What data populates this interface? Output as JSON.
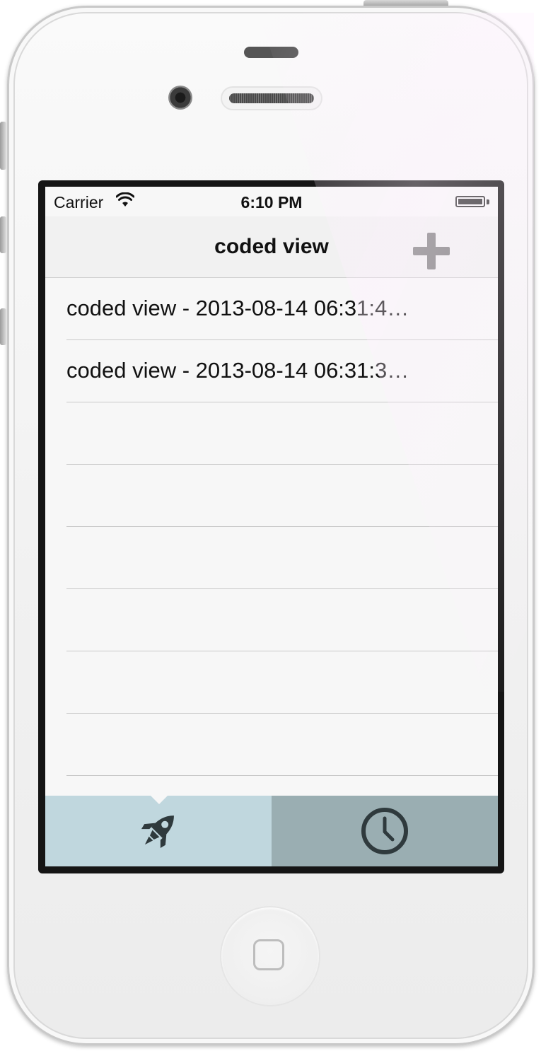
{
  "status_bar": {
    "carrier": "Carrier",
    "time": "6:10 PM"
  },
  "nav_bar": {
    "title": "coded view",
    "add_icon": "plus-icon"
  },
  "list": {
    "items": [
      {
        "label": "coded view - 2013-08-14 06:31:4…"
      },
      {
        "label": "coded view - 2013-08-14 06:31:3…"
      },
      {
        "label": ""
      },
      {
        "label": ""
      },
      {
        "label": ""
      },
      {
        "label": ""
      },
      {
        "label": ""
      },
      {
        "label": ""
      }
    ]
  },
  "tab_bar": {
    "tabs": [
      {
        "icon": "rocket-icon",
        "selected": true
      },
      {
        "icon": "clock-icon",
        "selected": false
      }
    ]
  },
  "colors": {
    "tab_selected": "#c0d7de",
    "tab_unselected": "#9aaeb2",
    "icon": "#2f3a3d",
    "nav_add_icon": "#808080"
  }
}
